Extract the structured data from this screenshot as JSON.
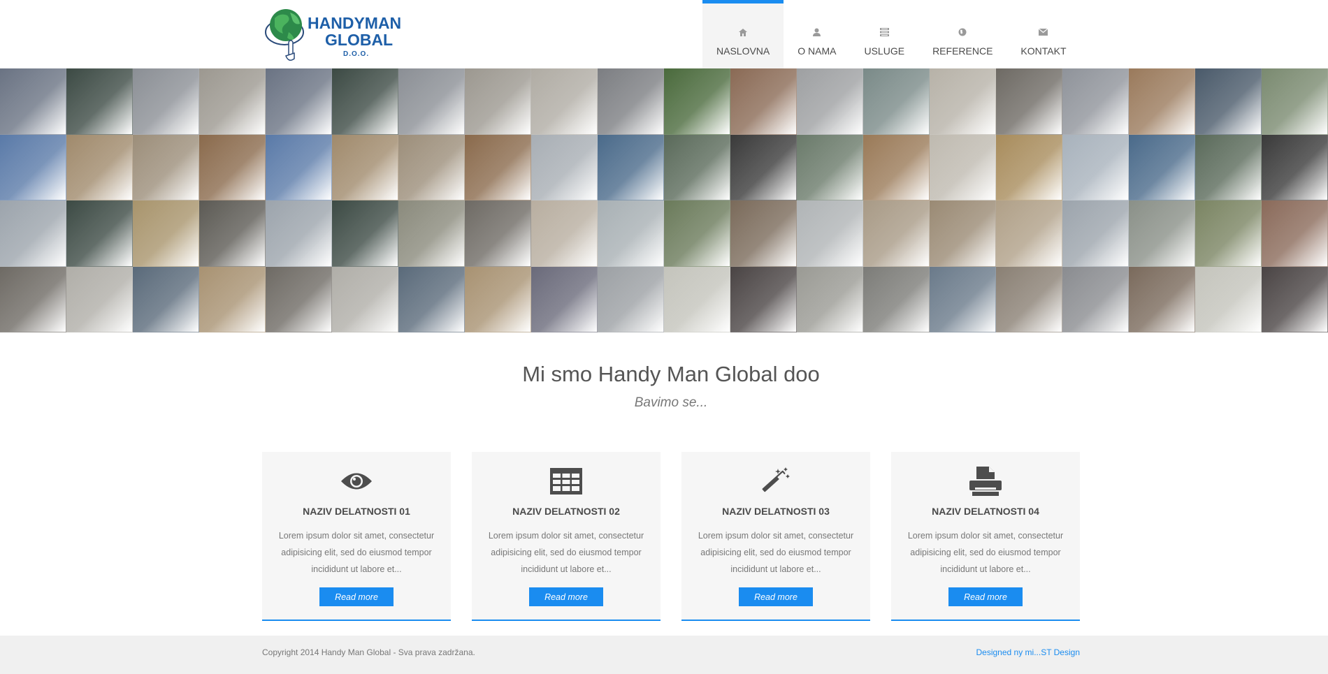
{
  "brand": {
    "line1": "HANDYMAN",
    "line2": "GLOBAL",
    "line3": "D.O.O.",
    "colors": {
      "primary": "#1e5fa8",
      "accent": "#1a8cf0"
    }
  },
  "nav": {
    "items": [
      {
        "label": "NASLOVNA",
        "icon": "home-icon",
        "active": true
      },
      {
        "label": "O NAMA",
        "icon": "user-icon",
        "active": false
      },
      {
        "label": "USLUGE",
        "icon": "list-icon",
        "active": false
      },
      {
        "label": "REFERENCE",
        "icon": "globe-icon",
        "active": false
      },
      {
        "label": "KONTAKT",
        "icon": "envelope-icon",
        "active": false
      }
    ]
  },
  "mosaic": {
    "tile_colors": [
      "#6a7383",
      "#3c4a44",
      "#8b8f95",
      "#9c9890",
      "#6a7383",
      "#3c4a44",
      "#8b8f95",
      "#9c9890",
      "#b0aca4",
      "#7c7e82",
      "#4a6a3c",
      "#8a6a55",
      "#9ea0a2",
      "#7a8a88",
      "#b7b2a8",
      "#6e6a64",
      "#8f939a",
      "#9a7a5c",
      "#4a5a6a",
      "#7a8a70",
      "#5a7aa8",
      "#a08a6c",
      "#9c8e7a",
      "#8a6a4c",
      "#5a7aa8",
      "#a08a6c",
      "#9c8e7a",
      "#8a6a4c",
      "#a8aeb4",
      "#4a6a8a",
      "#5a6a5a",
      "#3a3a3a",
      "#6a7a6a",
      "#9a7a58",
      "#bfbab0",
      "#a88c5c",
      "#a8b2bc",
      "#4a6a8a",
      "#5a6a5a",
      "#3a3a3a",
      "#9ca4ac",
      "#3c4a44",
      "#a8946c",
      "#5c5a54",
      "#9ca4ac",
      "#3c4a44",
      "#8a8a7c",
      "#6e6a64",
      "#b8aea0",
      "#a8b0b4",
      "#6a7a5a",
      "#7a6a5a",
      "#b0b4b6",
      "#a89a86",
      "#9a8a74",
      "#b0a088",
      "#9ca4ac",
      "#8a9088",
      "#7a8462",
      "#8a6a5a",
      "#6e6a64",
      "#b0aea8",
      "#5a6a7a",
      "#a89272",
      "#6e6a64",
      "#b0aea8",
      "#5a6a7a",
      "#a89272",
      "#6a6a7a",
      "#9ca0a4",
      "#c4c4bc",
      "#4a4444",
      "#9a9a94",
      "#7c7c78",
      "#6a7a8a",
      "#8a8074",
      "#8a8c90",
      "#7a6a5c",
      "#c4c4bc",
      "#4a4444"
    ]
  },
  "intro": {
    "title": "Mi smo Handy Man Global doo",
    "subtitle": "Bavimo se..."
  },
  "cards": [
    {
      "icon": "eye-icon",
      "title": "NAZIV DELATNOSTI 01",
      "text": "Lorem ipsum dolor sit amet, consectetur adipisicing elit, sed do eiusmod tempor incididunt ut labore et...",
      "button": "Read more"
    },
    {
      "icon": "table-icon",
      "title": "NAZIV DELATNOSTI 02",
      "text": "Lorem ipsum dolor sit amet, consectetur adipisicing elit, sed do eiusmod tempor incididunt ut labore et...",
      "button": "Read more"
    },
    {
      "icon": "magic-wand-icon",
      "title": "NAZIV DELATNOSTI 03",
      "text": "Lorem ipsum dolor sit amet, consectetur adipisicing elit, sed do eiusmod tempor incididunt ut labore et...",
      "button": "Read more"
    },
    {
      "icon": "printer-icon",
      "title": "NAZIV DELATNOSTI 04",
      "text": "Lorem ipsum dolor sit amet, consectetur adipisicing elit, sed do eiusmod tempor incididunt ut labore et...",
      "button": "Read more"
    }
  ],
  "footer": {
    "copyright": "Copyright 2014 Handy Man Global - Sva prava zadržana.",
    "designer": "Designed ny mi...ST Design"
  }
}
